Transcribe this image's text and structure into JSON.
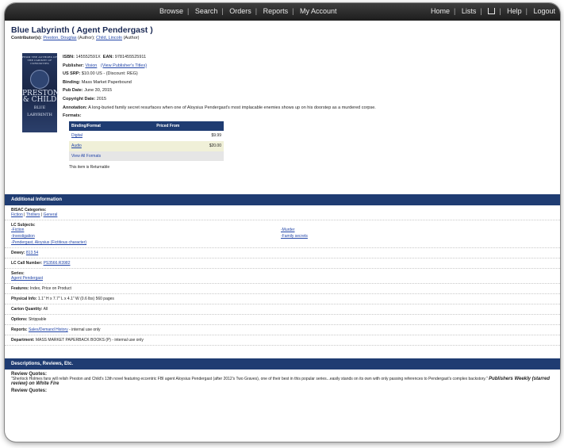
{
  "nav": {
    "center": [
      "Browse",
      "Search",
      "Orders",
      "Reports",
      "My Account"
    ],
    "right": [
      "Home",
      "Lists",
      "Help",
      "Logout"
    ]
  },
  "title": "Blue Labyrinth ( Agent Pendergast )",
  "contributors": {
    "label": "Contributor(s):",
    "items": [
      {
        "name": "Preston, Douglas",
        "role": "(Author);"
      },
      {
        "name": "Child, Lincoln",
        "role": "(Author)"
      }
    ]
  },
  "cover": {
    "tagline": "FROM THE AUTHORS OF THE CABINET OF CURIOSITIES",
    "author1": "PRESTON",
    "author2": "& CHILD",
    "title_line1": "BLUE",
    "title_line2": "LABYRINTH"
  },
  "details": {
    "isbn_label": "ISBN:",
    "isbn": "145552591X",
    "ean_label": "EAN:",
    "ean": "9781455525911",
    "publisher_label": "Publisher:",
    "publisher": "Vision",
    "publisher_titles": "(View Publisher's Titles)",
    "srp_label": "US SRP:",
    "srp": "$10.00 US  -  (Discount: REG)",
    "binding_label": "Binding:",
    "binding": "Mass Market Paperbound",
    "pubdate_label": "Pub Date:",
    "pubdate": "June 30, 2015",
    "copyright_label": "Copyright Date:",
    "copyright": "2015",
    "annotation_label": "Annotation:",
    "annotation": "A long-buried family secret resurfaces when one of Aloysius Pendergast's most implacable enemies shows up on his doorstep as a murdered corpse.",
    "formats_label": "Formats:"
  },
  "formats": {
    "headers": [
      "Binding/Format",
      "Priced From"
    ],
    "rows": [
      {
        "format": "Digital",
        "price": "$9.99"
      },
      {
        "format": "Audio",
        "price": "$20.00"
      }
    ],
    "view_all": "View All Formats"
  },
  "returnable": "This item is Returnable",
  "additional": {
    "header": "Additional Information",
    "bisac_label": "BISAC Categories:",
    "bisac": [
      "Fiction",
      "Thrillers",
      "General"
    ],
    "lc_label": "LC Subjects:",
    "lc_subjects": [
      "-Fiction",
      "-Murder",
      "-Investigation",
      "-Family secrets",
      "-Pendergast, Aloysius (Fictitious character)"
    ],
    "dewey_label": "Dewey:",
    "dewey": "813.54",
    "lc_call_label": "LC Call Number:",
    "lc_call": "PS3566.R3982",
    "series_label": "Series:",
    "series": "Agent Pendergast",
    "features_label": "Features:",
    "features": "Index, Price on Product",
    "physical_label": "Physical Info:",
    "physical": "1.1\" H x 7.7\" L x 4.1\" W (0.6 lbs) 560 pages",
    "carton_label": "Carton Quantity:",
    "carton": "All",
    "options_label": "Options:",
    "options": "Strippable",
    "reports_label": "Reports:",
    "reports_link": "Sales/Demand History",
    "reports_note": " - internal use only",
    "dept_label": "Department:",
    "dept": "MASS MARKET PAPERBACK BOOKS (P) - internal use only"
  },
  "descriptions": {
    "header": "Descriptions, Reviews, Etc.",
    "review_label": "Review Quotes:",
    "review_text": "\"Sherlock Holmes fans will relish Preston and Child's 13th novel featuring eccentric FBI agent Aloysius Pendergast (after 2012's Two Graves), one of their best in this popular series...easily stands on its own with only passing references to Pendergast's complex backstory.\"",
    "review_source": "Publishers Weekly (starred review) on White Fire",
    "review_label2": "Review Quotes:"
  }
}
